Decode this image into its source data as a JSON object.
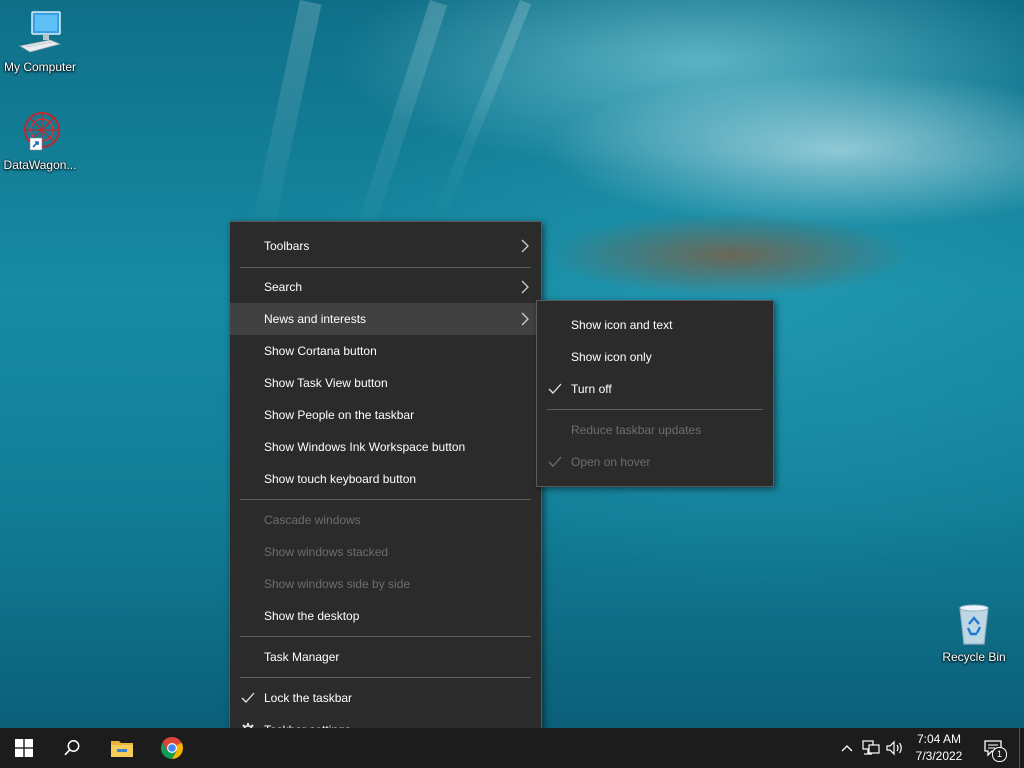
{
  "desktop": {
    "icons": [
      {
        "label": "My Computer"
      },
      {
        "label": "DataWagon..."
      },
      {
        "label": "Recycle Bin"
      }
    ]
  },
  "context_menu": {
    "items": [
      {
        "label": "Toolbars",
        "submenu": true
      },
      {
        "label": "Search",
        "submenu": true
      },
      {
        "label": "News and interests",
        "submenu": true,
        "highlighted": true
      },
      {
        "label": "Show Cortana button"
      },
      {
        "label": "Show Task View button"
      },
      {
        "label": "Show People on the taskbar"
      },
      {
        "label": "Show Windows Ink Workspace button"
      },
      {
        "label": "Show touch keyboard button"
      },
      {
        "label": "Cascade windows",
        "disabled": true
      },
      {
        "label": "Show windows stacked",
        "disabled": true
      },
      {
        "label": "Show windows side by side",
        "disabled": true
      },
      {
        "label": "Show the desktop"
      },
      {
        "label": "Task Manager"
      },
      {
        "label": "Lock the taskbar",
        "checked": true
      },
      {
        "label": "Taskbar settings",
        "icon": "gear-icon"
      }
    ]
  },
  "submenu": {
    "items": [
      {
        "label": "Show icon and text"
      },
      {
        "label": "Show icon only"
      },
      {
        "label": "Turn off",
        "checked": true
      },
      {
        "label": "Reduce taskbar updates",
        "disabled": true
      },
      {
        "label": "Open on hover",
        "disabled": true,
        "checked": true
      }
    ]
  },
  "taskbar": {
    "clock": {
      "time": "7:04 AM",
      "date": "7/3/2022"
    },
    "notification_count": "1",
    "pinned": [
      "windows-start-icon",
      "search-icon",
      "file-explorer-icon",
      "chrome-icon"
    ],
    "tray_icons": [
      "chevron-up-icon",
      "network-icon",
      "volume-icon",
      "action-center-icon"
    ]
  },
  "colors": {
    "menu_bg": "#2b2b2b",
    "menu_highlight": "#414141",
    "disabled_text": "#6d6d6d",
    "taskbar_bg": "#1c1c1c"
  }
}
